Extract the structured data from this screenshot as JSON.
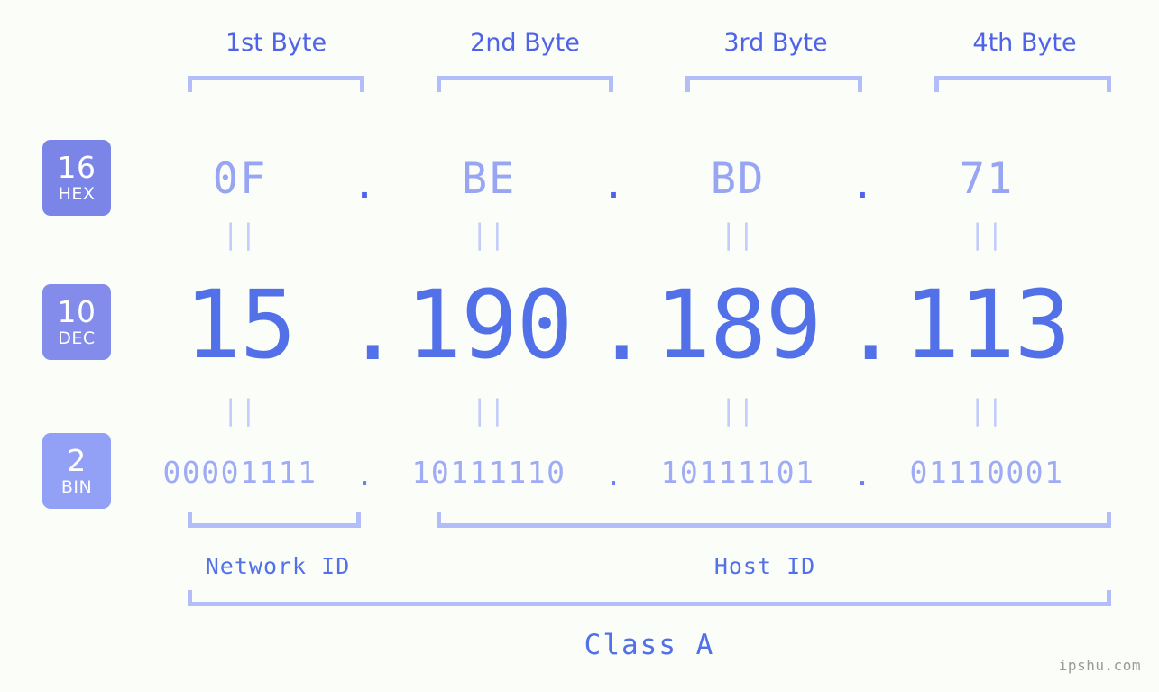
{
  "watermark": "ipshu.com",
  "byte_headers": [
    {
      "label": "1st Byte"
    },
    {
      "label": "2nd Byte"
    },
    {
      "label": "3rd Byte"
    },
    {
      "label": "4th Byte"
    }
  ],
  "bases": [
    {
      "num": "16",
      "name": "HEX",
      "color": "#7b85e8"
    },
    {
      "num": "10",
      "name": "DEC",
      "color": "#838cea"
    },
    {
      "num": "2",
      "name": "BIN",
      "color": "#92a0f5"
    }
  ],
  "separator": ".",
  "equals_mark": "||",
  "rows": {
    "hex": {
      "octets": [
        "0F",
        "BE",
        "BD",
        "71"
      ]
    },
    "dec": {
      "octets": [
        "15",
        "190",
        "189",
        "113"
      ]
    },
    "bin": {
      "octets": [
        "00001111",
        "10111110",
        "10111101",
        "01110001"
      ]
    }
  },
  "segments": {
    "network_id": "Network ID",
    "host_id": "Host ID",
    "class": "Class A"
  },
  "colors": {
    "background": "#fbfdf8",
    "primary": "#5271e8",
    "light": "#98a5f3",
    "bracket": "#b3bdfa",
    "equals": "#c3ccfb",
    "watermark": "#9a9a9a"
  }
}
